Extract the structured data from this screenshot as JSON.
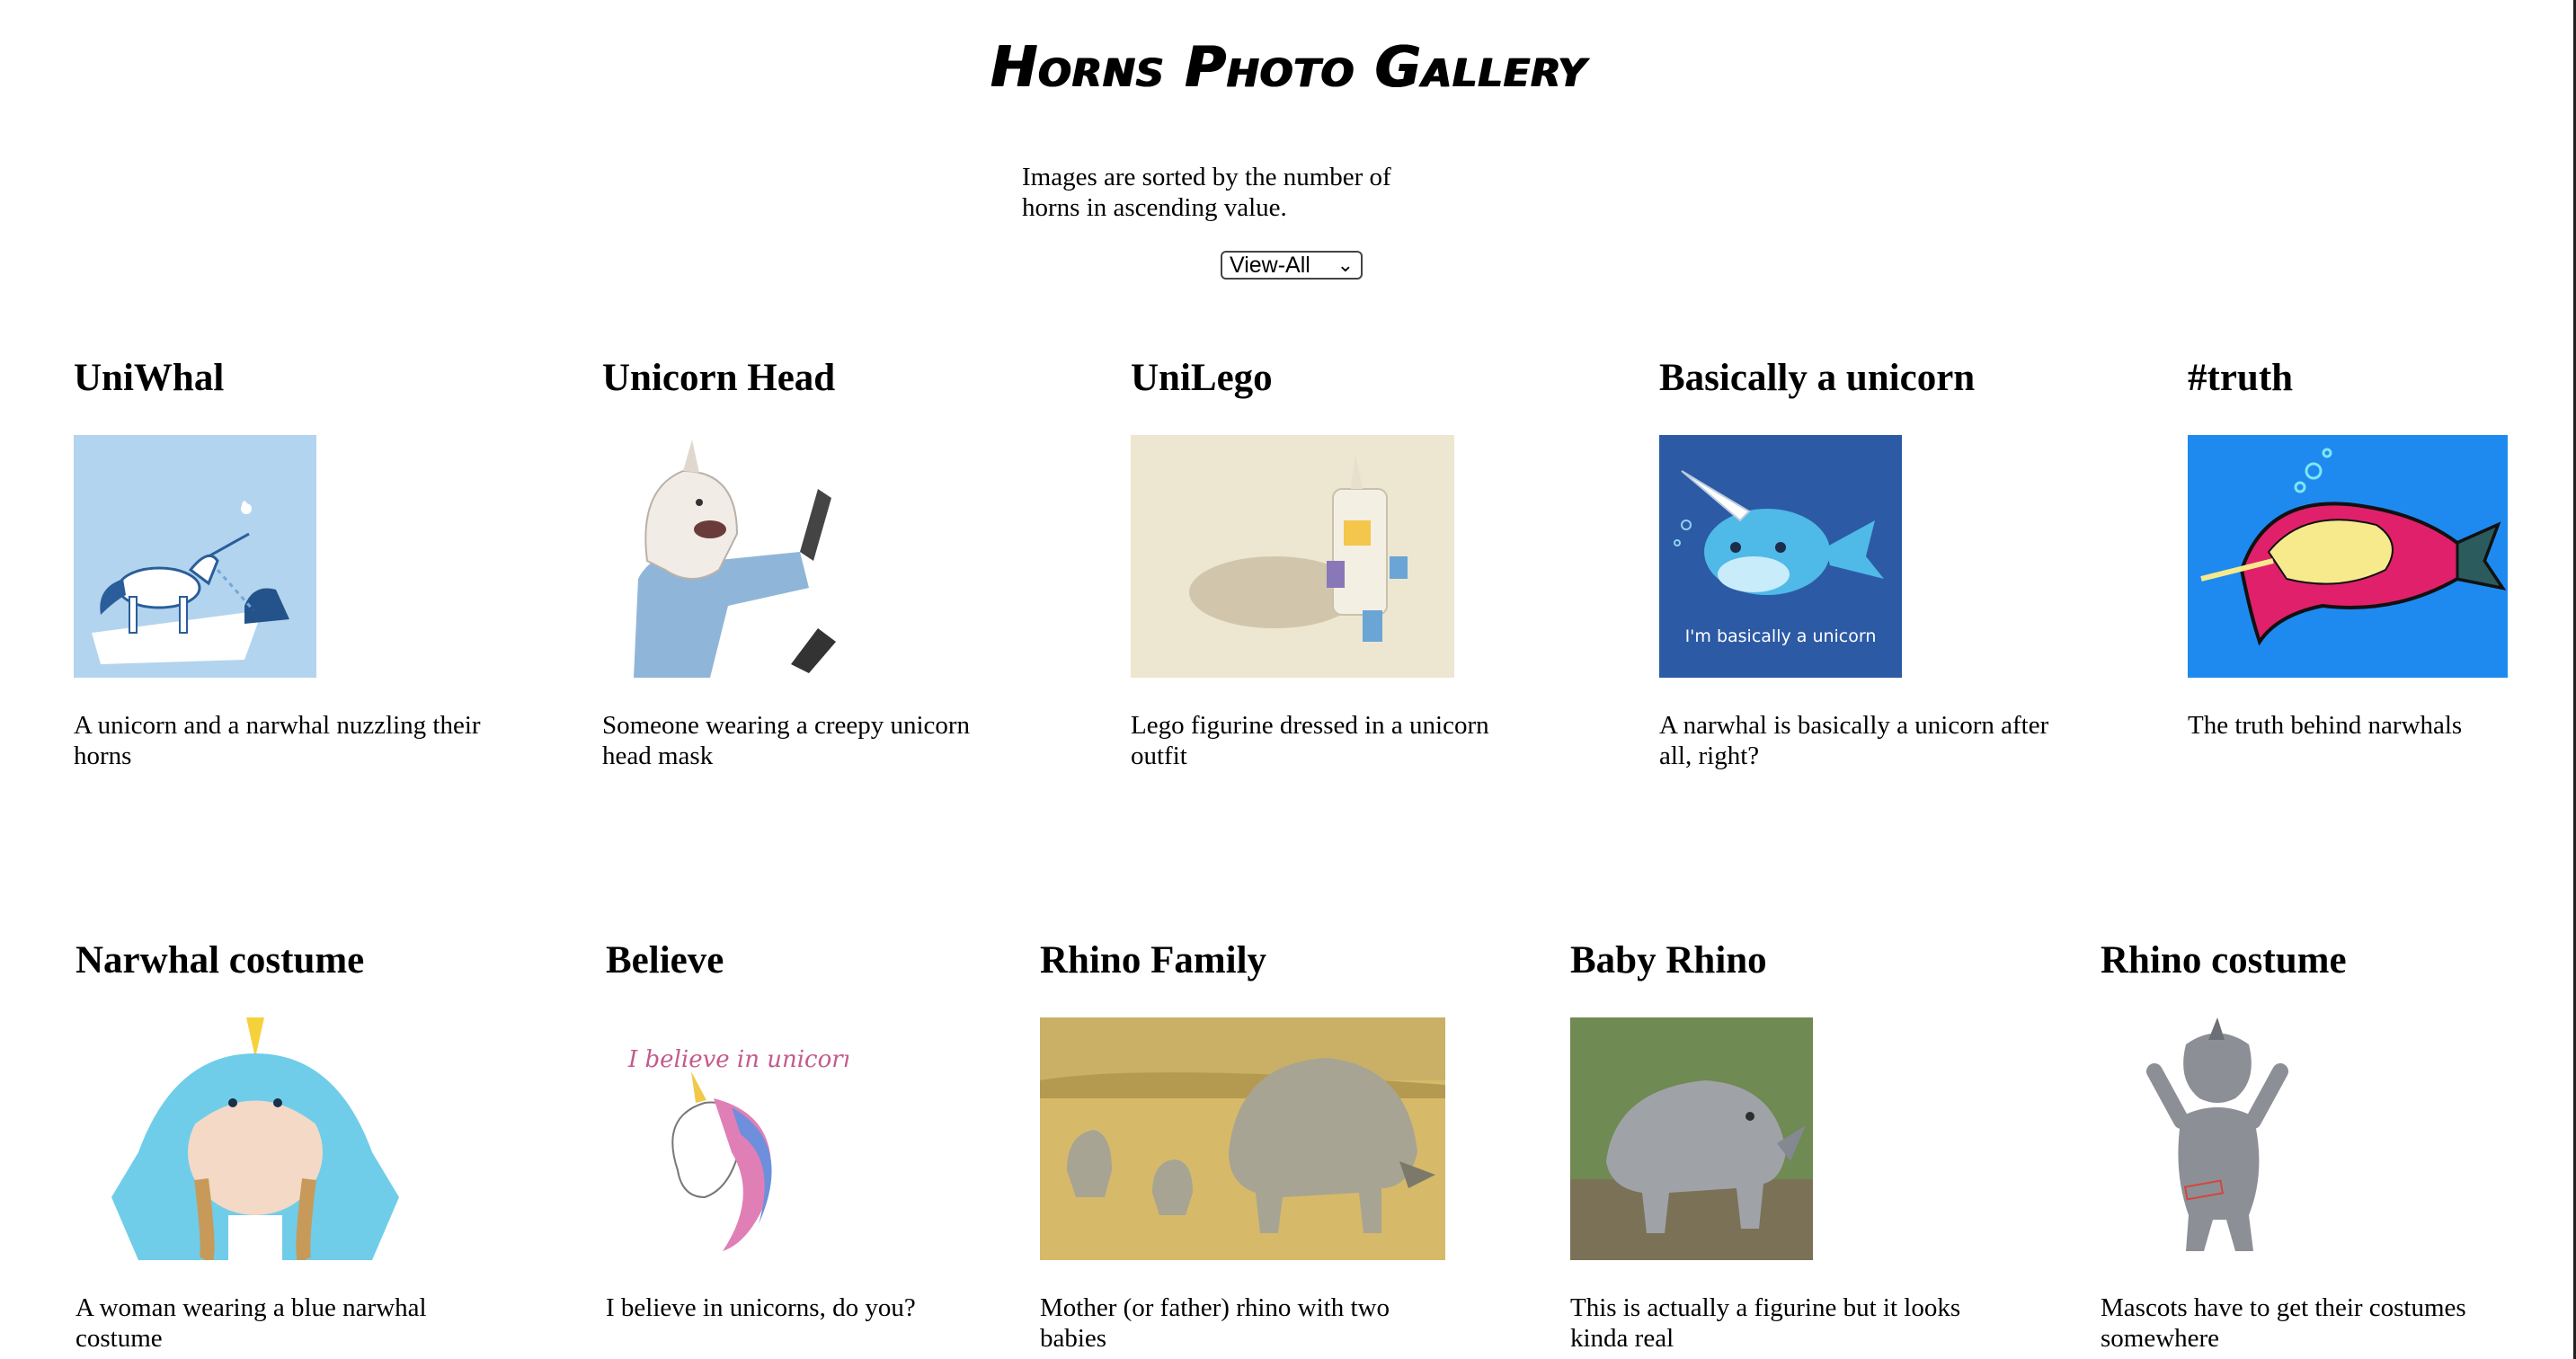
{
  "page": {
    "title": "Horns Photo Gallery",
    "intro": "Images are sorted by the number of horns in ascending value.",
    "filter": {
      "selected": "View-All"
    }
  },
  "cards": [
    {
      "title": "UniWhal",
      "description": "A unicorn and a narwhal nuzzling their horns"
    },
    {
      "title": "Unicorn Head",
      "description": "Someone wearing a creepy unicorn head mask"
    },
    {
      "title": "UniLego",
      "description": "Lego figurine dressed in a unicorn outfit"
    },
    {
      "title": "Basically a unicorn",
      "description": "A narwhal is basically a unicorn after all, right?",
      "image_text": "I'm basically a unicorn"
    },
    {
      "title": "#truth",
      "description": "The truth behind narwhals"
    },
    {
      "title": "Narwhal costume",
      "description": "A woman wearing a blue narwhal costume"
    },
    {
      "title": "Believe",
      "description": "I believe in unicorns, do you?",
      "image_text": "I believe in unicorns"
    },
    {
      "title": "Rhino Family",
      "description": "Mother (or father) rhino with two babies"
    },
    {
      "title": "Baby Rhino",
      "description": "This is actually a figurine but it looks kinda real"
    },
    {
      "title": "Rhino costume",
      "description": "Mascots have to get their costumes somewhere"
    }
  ]
}
